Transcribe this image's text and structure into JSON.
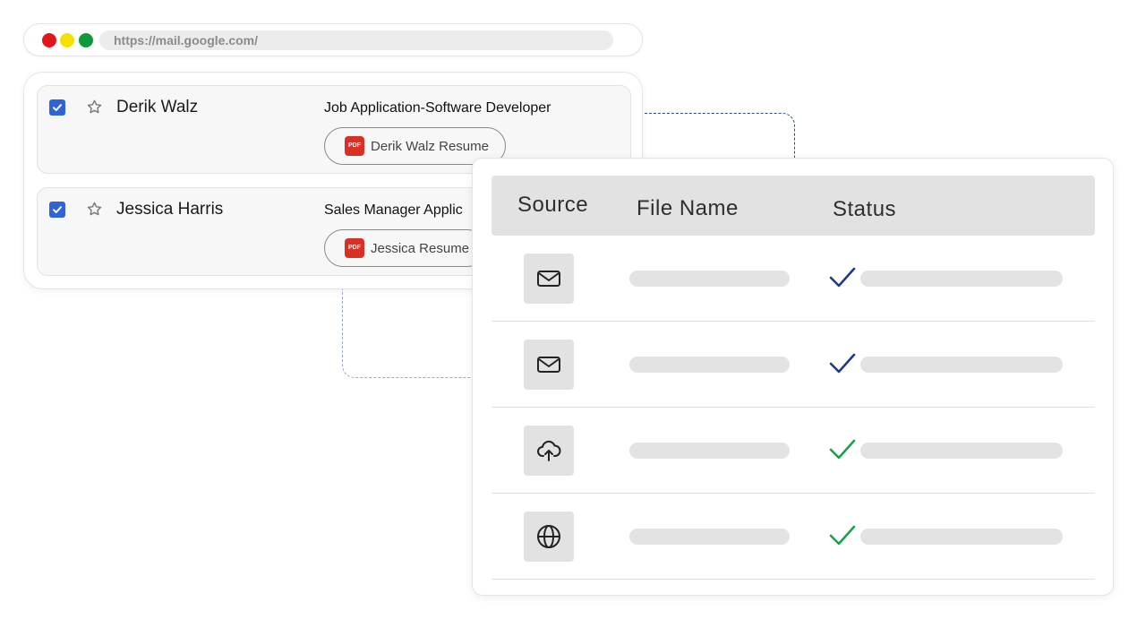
{
  "browser": {
    "url": "https://mail.google.com/"
  },
  "inbox": {
    "emails": [
      {
        "sender": "Derik Walz",
        "subject": "Job Application-Software Developer",
        "attachment": "Derik Walz Resume",
        "attachment_type": "PDF",
        "checked": true
      },
      {
        "sender": "Jessica Harris",
        "subject": "Sales Manager Applic",
        "attachment": "Jessica Resume",
        "attachment_type": "PDF",
        "checked": true
      }
    ]
  },
  "file_table": {
    "columns": [
      "Source",
      "File Name",
      "Status"
    ],
    "rows": [
      {
        "source_icon": "mail-icon",
        "status_icon": "check-icon",
        "status_color": "#1f3a8a"
      },
      {
        "source_icon": "mail-icon",
        "status_icon": "check-icon",
        "status_color": "#1f3a8a"
      },
      {
        "source_icon": "cloud-upload-icon",
        "status_icon": "check-icon",
        "status_color": "#16a34a"
      },
      {
        "source_icon": "globe-icon",
        "status_icon": "check-icon",
        "status_color": "#16a34a"
      }
    ]
  },
  "colors": {
    "checkbox": "#2f63d6",
    "pdf": "#d93025",
    "traffic_red": "#e3161b",
    "traffic_yellow": "#f5e000",
    "traffic_green": "#0c9a3a"
  }
}
